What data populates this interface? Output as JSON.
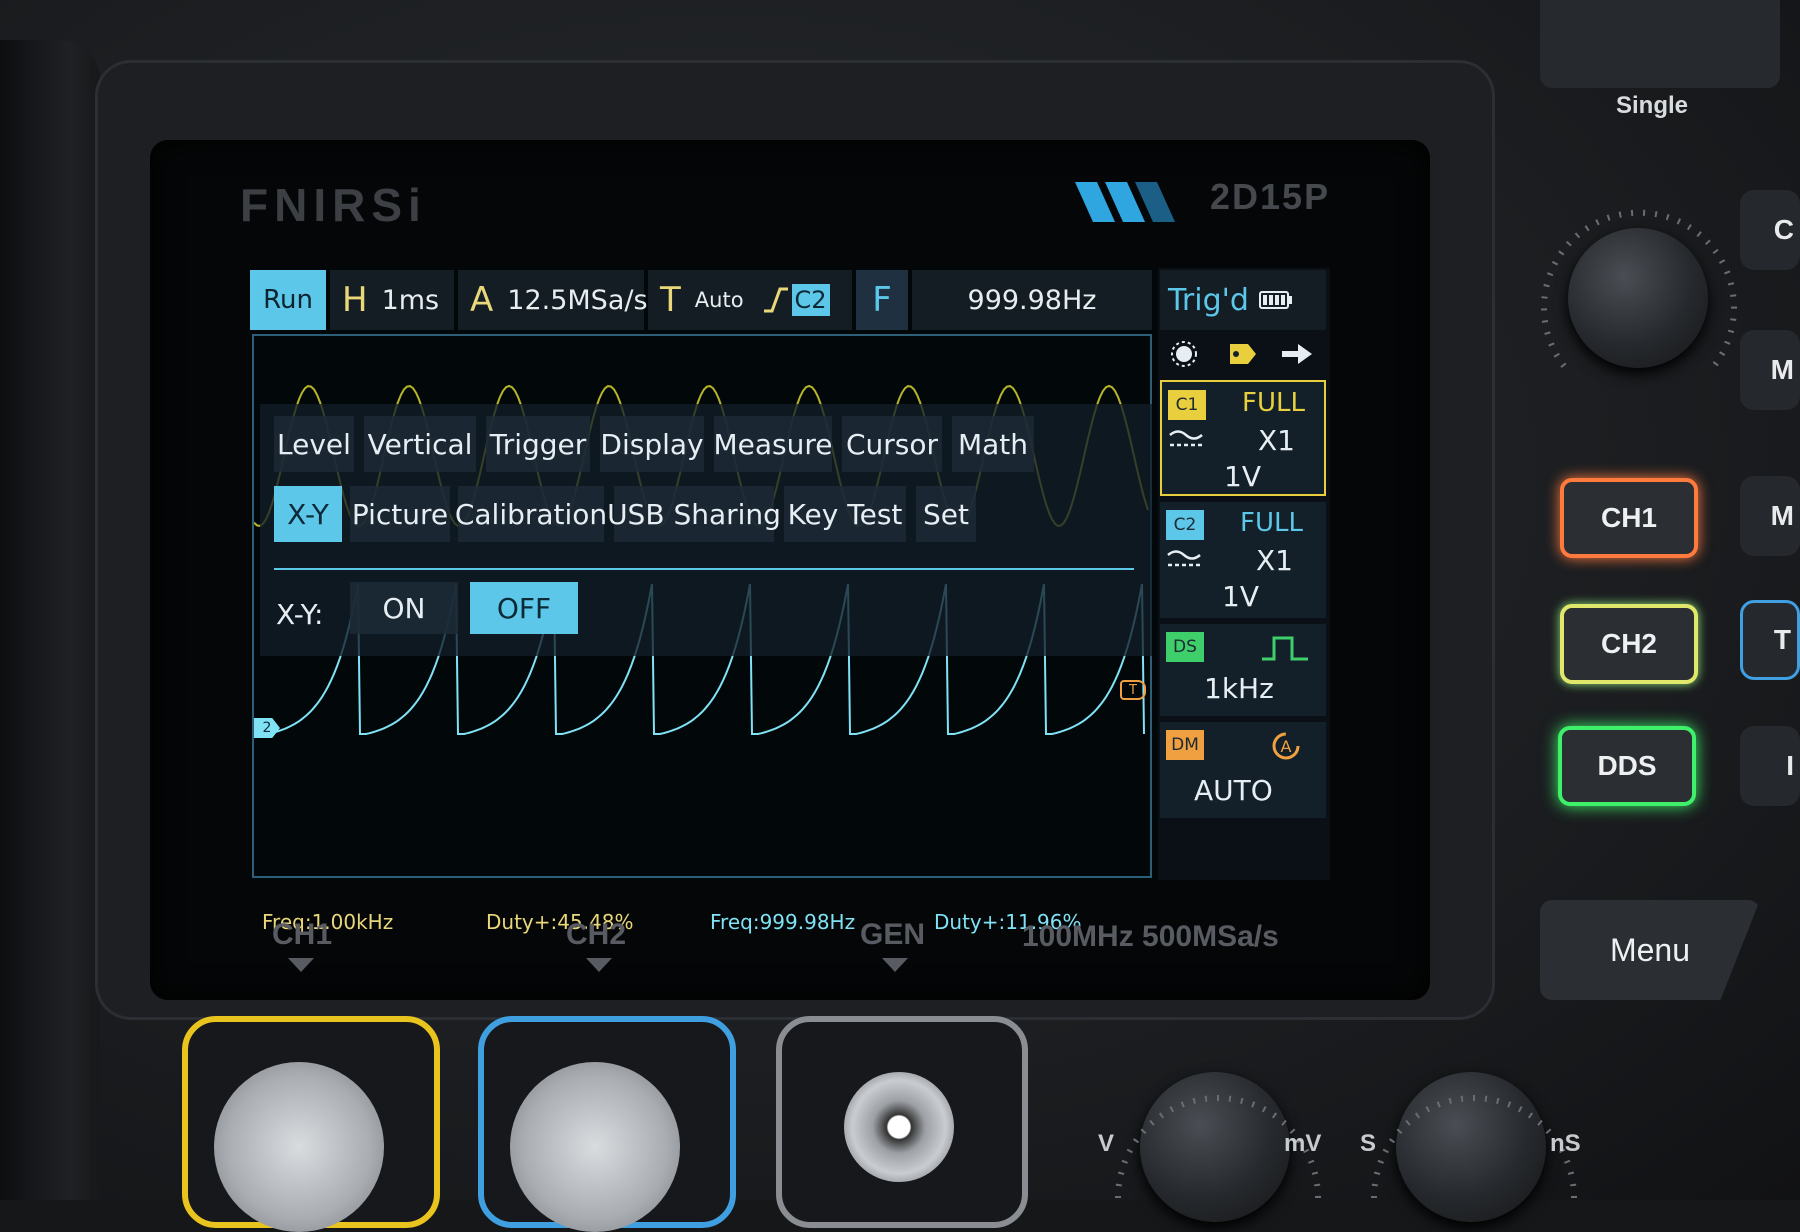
{
  "device": {
    "brand": "FNIRSi",
    "model": "2D15P",
    "spec_label": "100MHz 500MSa/s",
    "single_label": "Single"
  },
  "header": {
    "run_state": "Run",
    "horizontal": {
      "key": "H",
      "value": "1ms"
    },
    "acquisition": {
      "key": "A",
      "value": "12.5MSa/s"
    },
    "trigger": {
      "key": "T",
      "mode": "Auto",
      "source": "C2"
    },
    "frequency": {
      "key": "F",
      "value": "999.98Hz"
    },
    "status": "Trig'd"
  },
  "menu": {
    "row1": [
      "Level",
      "Vertical",
      "Trigger",
      "Display",
      "Measure",
      "Cursor",
      "Math"
    ],
    "row2": [
      "X-Y",
      "Picture",
      "Calibration",
      "USB Sharing",
      "Key Test",
      "Set"
    ],
    "selected": "X-Y",
    "xy_label": "X-Y:",
    "options": {
      "on": "ON",
      "off": "OFF",
      "selected": "OFF"
    }
  },
  "measurements": {
    "ch1_freq": "Freq:1.00kHz",
    "ch1_duty": "Duty+:45.48%",
    "ch2_freq": "Freq:999.98Hz",
    "ch2_duty": "Duty+:11.96%"
  },
  "markers": {
    "ch2": "2",
    "trigger": "T"
  },
  "channels": [
    {
      "tag": "C1",
      "bandwidth": "FULL",
      "probe": "X1",
      "scale": "1V",
      "color": "#e9cf3e",
      "selected": true
    },
    {
      "tag": "C2",
      "bandwidth": "FULL",
      "probe": "X1",
      "scale": "1V",
      "color": "#5cc7e8",
      "selected": false
    }
  ],
  "dds": {
    "tag": "DS",
    "frequency": "1kHz",
    "color": "#3ecf6a"
  },
  "dmm": {
    "tag": "DM",
    "mode": "AUTO",
    "color": "#f0a040"
  },
  "buttons": {
    "ch1": "CH1",
    "ch2": "CH2",
    "dds": "DDS",
    "menu": "Menu",
    "side_keys": [
      "C",
      "M",
      "M",
      "T",
      "I"
    ]
  },
  "ports": {
    "ch1": "CH1",
    "ch2": "CH2",
    "gen": "GEN"
  },
  "knob_labels": {
    "v": "V",
    "mv": "mV",
    "s": "S",
    "ns": "nS"
  },
  "colors": {
    "ch1_trace": "#b5b52a",
    "ch2_trace": "#7fe2f5",
    "accent": "#5cc7e8",
    "ch1_button_glow": "#ff7a3d",
    "ch2_button_glow": "#dfe86a",
    "dds_button_glow": "#3ef06a"
  }
}
